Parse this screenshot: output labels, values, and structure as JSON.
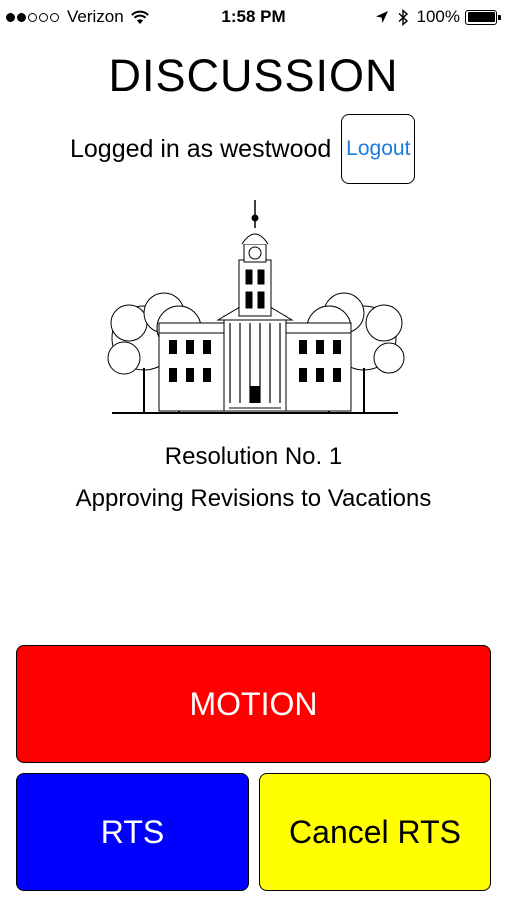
{
  "status_bar": {
    "carrier": "Verizon",
    "signal_bars_filled": 2,
    "signal_bars_total": 5,
    "time": "1:58 PM",
    "battery_percent": "100%",
    "icons": [
      "signal-dots-icon",
      "wifi-icon",
      "location-arrow-icon",
      "bluetooth-icon",
      "battery-icon"
    ]
  },
  "header": {
    "title": "DISCUSSION"
  },
  "session": {
    "logged_in_text": "Logged in as westwood",
    "logout_label": "Logout"
  },
  "image": {
    "name": "courthouse-illustration"
  },
  "resolution": {
    "number": "Resolution No. 1",
    "subject": "Approving Revisions to Vacations"
  },
  "actions": {
    "motion_label": "MOTION",
    "rts_label": "RTS",
    "cancel_rts_label": "Cancel RTS"
  },
  "colors": {
    "motion": "#ff0000",
    "rts": "#0000ff",
    "cancel_rts": "#ffff00",
    "link": "#1a7be0"
  }
}
